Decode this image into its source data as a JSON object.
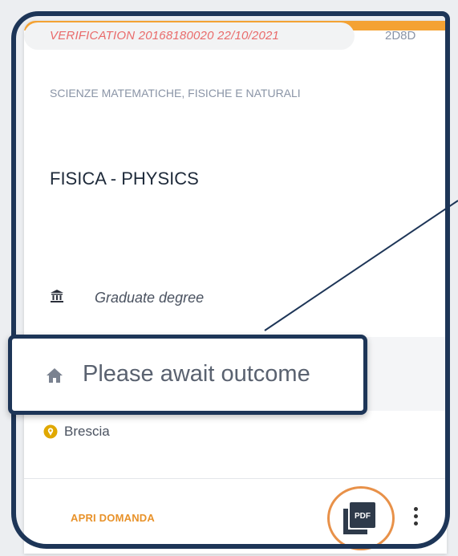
{
  "card": {
    "verification_label": "VERIFICATION  20168180020  22/10/2021",
    "code": "2D8D",
    "faculty": "SCIENZE MATEMATICHE, FISICHE E NATURALI",
    "course": "FISICA - PHYSICS",
    "degree_type": "Graduate  degree",
    "city": "Brescia",
    "open_button_label": "APRI DOMANDA",
    "pdf_icon_text": "PDF"
  },
  "callout": {
    "status_text": "Please await outcome"
  },
  "icons": {
    "degree": "institution-icon",
    "city": "location-pin-icon",
    "status": "home-icon",
    "pdf": "pdf-icon",
    "menu": "more-vertical-icon"
  },
  "colors": {
    "accent_orange": "#f4a233",
    "verification_red": "#e96b6b",
    "frame_navy": "#1d3557",
    "highlight_ring": "#e89149",
    "pin_gold": "#e0a800"
  }
}
